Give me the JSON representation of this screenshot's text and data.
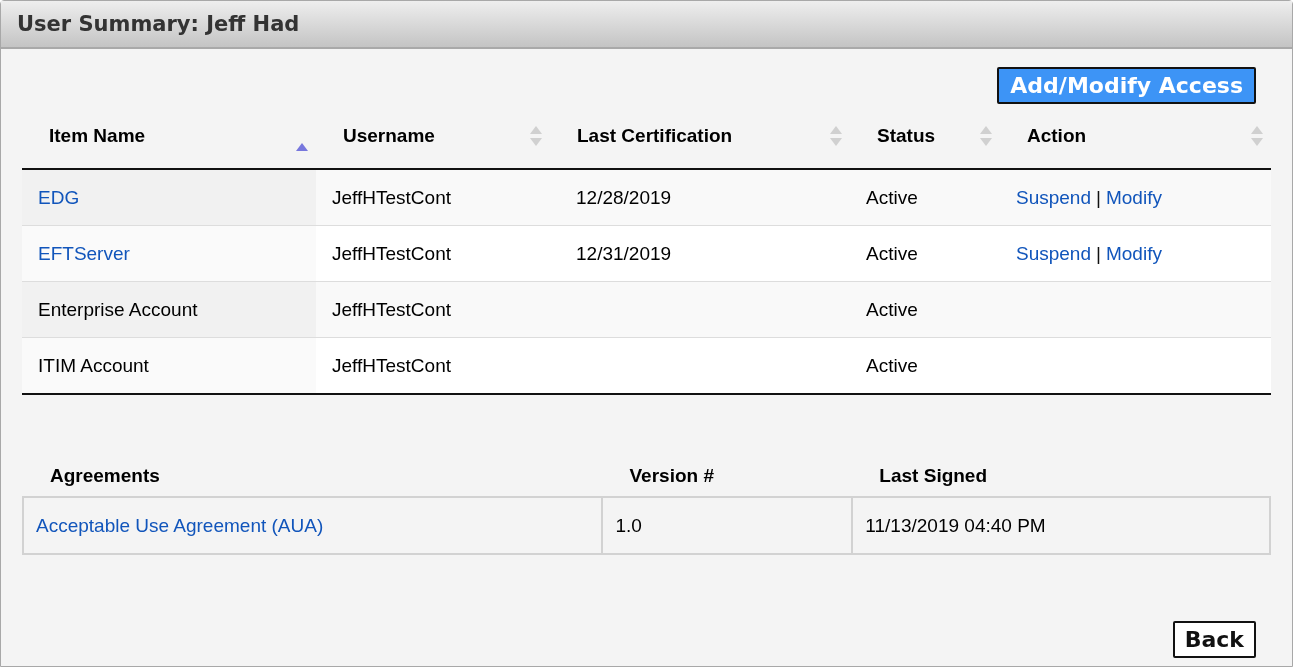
{
  "window": {
    "title": "User Summary: Jeff Had"
  },
  "add_button": "Add/Modify Access",
  "items_table": {
    "columns": [
      {
        "label": "Item Name",
        "sorted": true
      },
      {
        "label": "Username",
        "sorted": false
      },
      {
        "label": "Last Certification",
        "sorted": false
      },
      {
        "label": "Status",
        "sorted": false
      },
      {
        "label": "Action",
        "sorted": false
      }
    ],
    "rows": [
      {
        "item_name": "EDG",
        "link": true,
        "username": "JeffHTestCont",
        "last_certification": "12/28/2019",
        "status": "Active",
        "actions": [
          "Suspend",
          "Modify"
        ],
        "separator": "|"
      },
      {
        "item_name": "EFTServer",
        "link": true,
        "username": "JeffHTestCont",
        "last_certification": "12/31/2019",
        "status": "Active",
        "actions": [
          "Suspend",
          "Modify"
        ],
        "separator": "|"
      },
      {
        "item_name": "Enterprise Account",
        "link": false,
        "username": "JeffHTestCont",
        "status": "Active",
        "actions": []
      },
      {
        "item_name": "ITIM Account",
        "link": false,
        "username": "JeffHTestCont",
        "status": "Active",
        "actions": []
      }
    ]
  },
  "agreements_table": {
    "columns": [
      "Agreements",
      "Version #",
      "Last Signed"
    ],
    "rows": [
      {
        "agreement": "Acceptable Use Agreement (AUA)",
        "version": "1.0",
        "last_signed": "11/13/2019 04:40 PM"
      }
    ]
  },
  "back_button": "Back"
}
